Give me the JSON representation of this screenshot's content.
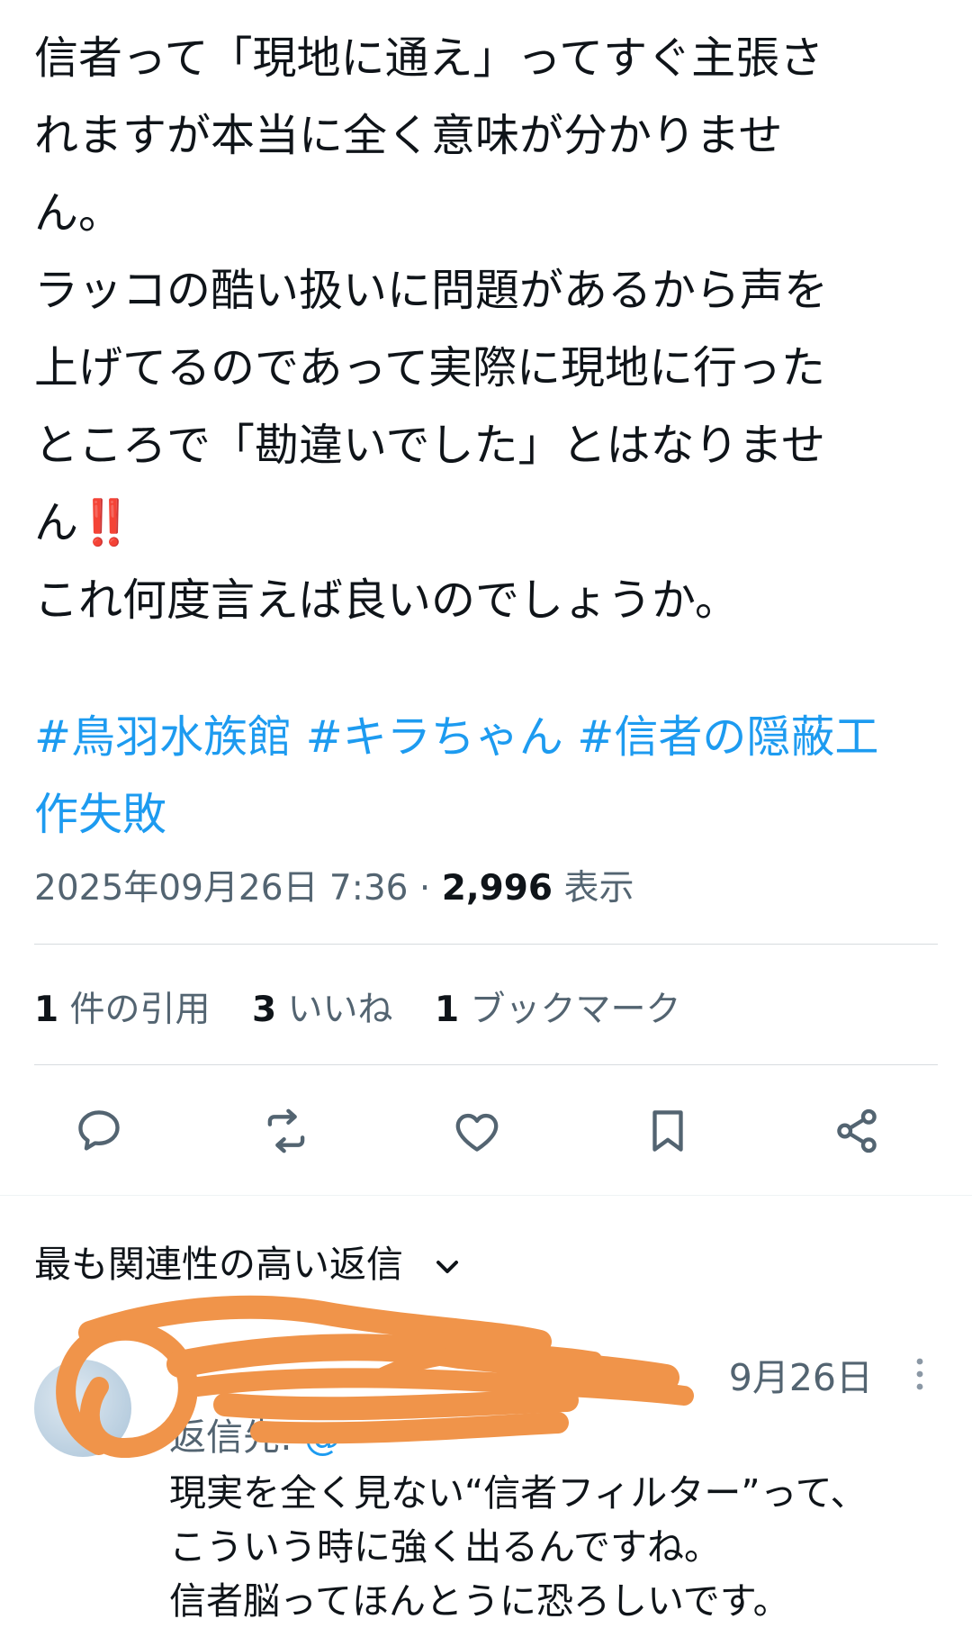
{
  "tweet": {
    "lines": [
      "信者って「現地に通え」ってすぐ主張さ",
      "れますが本当に全く意味が分かりませ",
      "ん。",
      "ラッコの酷い扱いに問題があるから声を",
      "上げてるのであって実際に現地に行った",
      "ところで「勘違いでした」とはなりませ",
      "ん",
      "これ何度言えば良いのでしょうか。"
    ],
    "emphasis": "‼️",
    "hashtag_lines": [
      [
        "#鳥羽水族館",
        "#キラちゃん",
        "#信者の隠蔽工"
      ],
      [
        "作失敗"
      ]
    ]
  },
  "meta": {
    "datetime": "2025年09月26日 7:36",
    "separator": "·",
    "views_count": "2,996",
    "views_label": "表示"
  },
  "stats": [
    {
      "count": "1",
      "label": "件の引用"
    },
    {
      "count": "3",
      "label": "いいね"
    },
    {
      "count": "1",
      "label": "ブックマーク"
    }
  ],
  "actions": [
    "reply-icon",
    "retweet-icon",
    "like-icon",
    "bookmark-icon",
    "share-icon"
  ],
  "replies_section": {
    "sort_label": "最も関連性の高い返信"
  },
  "reply": {
    "date": "9月26日",
    "reply_to_label": "返信先:",
    "reply_to_handle": "@",
    "lines": [
      "現実を全く見ない“信者フィルター”って、",
      "こういう時に強く出るんですね。",
      "信者脳ってほんとうに恐ろしいです。"
    ]
  },
  "colors": {
    "text": "#0f1419",
    "secondary": "#536471",
    "link": "#1d9bf0",
    "redaction": "#f0944a"
  }
}
